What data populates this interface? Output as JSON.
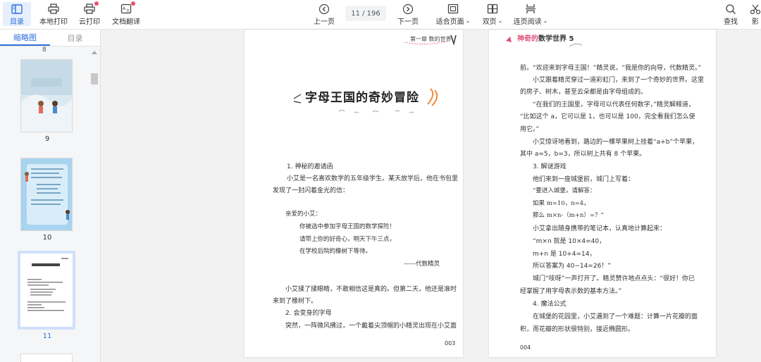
{
  "toolbar": {
    "left_buttons": [
      {
        "label": "目录",
        "icon": "sidebar-panel-icon",
        "active": true
      },
      {
        "label": "本地打印",
        "icon": "printer-icon"
      },
      {
        "label": "云打印",
        "icon": "cloud-printer-icon",
        "badge": true
      },
      {
        "label": "文档翻译",
        "icon": "translate-icon",
        "badge": true
      }
    ],
    "prev_label": "上一页",
    "next_label": "下一页",
    "page_indicator": "11 / 196",
    "fit_label": "适合页面",
    "double_label": "双页",
    "continuous_label": "连页阅读",
    "search_label": "查找",
    "cut_label": "影"
  },
  "sidebar": {
    "tab_thumbnails": "缩略图",
    "tab_toc": "目录",
    "top_label": "8",
    "thumbs": [
      {
        "label": "9"
      },
      {
        "label": "10"
      },
      {
        "label": "11",
        "selected": true
      }
    ]
  },
  "left_page": {
    "header": "第一章  数的世界",
    "title": "字母王国的奇妙冒险",
    "lines": [
      "1.  神秘的邀请函",
      "小艾是一名喜欢数学的五年级学生。某天放学后，他在书包里",
      "发现了一封闪着金光的信：",
      "亲爱的小艾：",
      "你被选中参加字母王国的数学探险！",
      "请带上你的好奇心，明天下午三点，",
      "在学校后院的橡树下等待。",
      "——代数精灵",
      "小艾揉了揉眼睛，不敢相信这是真的。但第二天，他还是准时",
      "来到了橡树下。",
      "2.  会变身的字母",
      "突然，一阵微风拂过，一个戴着尖顶帽的小精灵出现在小艾面"
    ],
    "page_number": "003"
  },
  "right_page": {
    "header_prefix": "神奇的",
    "header_main": "数学世界 5",
    "lines": [
      "前。“欢迎来到字母王国！”精灵说，“我是你的向导，代数精灵。”",
      "小艾跟着精灵穿过一道彩虹门，来到了一个奇妙的世界。这里",
      "的房子、树木，甚至云朵都是由字母组成的。",
      "“在我们的王国里，字母可以代表任何数字，”精灵解释道，",
      "“比如这个 a，它可以是 1，也可以是 100，完全看我们怎么使",
      "用它。”",
      "小艾惊讶地看到，路边的一棵苹果树上挂着“a+b”个苹果，",
      "其中 a=5，b=3，所以树上共有 8 个苹果。",
      "3.  解谜游戏",
      "他们来到一座城堡前，城门上写着：",
      "“要进入城堡，请解答：",
      "如果 m=10，n=4，",
      "那么 m×n-（m+n）=？”",
      "小艾拿出随身携带的笔记本，认真地计算起来：",
      "“m×n 就是 10×4=40，",
      "m+n 是 10+4=14，",
      "所以答案为 40−14=26！”",
      "城门“吱呀”一声打开了。精灵赞许地点点头：“很好！你已",
      "经掌握了用字母表示数的基本方法。”",
      "4.  魔法公式",
      "在城堡的花园里，小艾遇到了一个难题：计算一片花瓣的面",
      "积，而花瓣的形状很特别，接近椭圆形。"
    ],
    "page_number": "004"
  },
  "colors": {
    "accent": "#2f6fdb",
    "badge": "#f0506e",
    "title_decoration": "#f08a3c"
  }
}
